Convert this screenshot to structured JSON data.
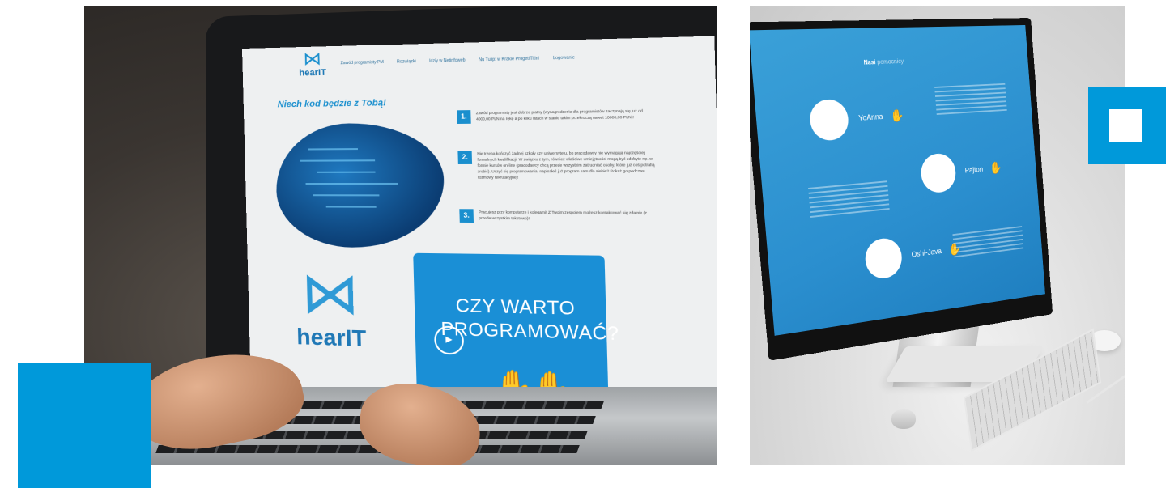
{
  "colors": {
    "accent": "#0099da",
    "screen_blue": "#1a8fd6"
  },
  "laptop_photo": {
    "site": {
      "logo_text": "hearIT",
      "nav": [
        "Zawód programisty PM",
        "Rozwiązki",
        "Idziy w Netinfoweb",
        "Nu Tulip: w Krakie ProgetITitini",
        "Logowanie"
      ],
      "headline": "Niech kod będzie z Tobą!",
      "points": [
        {
          "num": "1.",
          "text": "Zawód programisty jest dobrze płatny (wynagrodzenia dla programistów zaczynają się już od 4000,00 PLN na rękę a po kilku latach w stanie takim przekroczą nawet 10000,00 PLN)!"
        },
        {
          "num": "2.",
          "text": "Nie trzeba kończyć żadnej szkoły czy uniwersytetu, bo pracodawcy nie wymagają najczęściej formalnych kwalifikacji. W związku z tym, również właściwe umiejętności mogą być zdobyte np. w formie kursów on-line (pracodawcy chcą przede wszystkim zatrudniać osoby, które już coś potrafią zrobić). Uczyć się programowania, napisałeś już program sam dla siebie? Pokaż go podczas rozmowy rekrutacyjnej!"
        },
        {
          "num": "3.",
          "text": "Pracujesz przy komputerze i kolegami! Z Twoim zespołem możesz kontaktować się zdalnie (z przede wszystkim tekstowo)!"
        }
      ],
      "big_logo_text": "hearIT",
      "video_title": "CZY WARTO PROGRAMOWAĆ?"
    }
  },
  "desktop_photo": {
    "section_title": "Nasi",
    "section_title_rest": "pomocnicy",
    "items": [
      {
        "name": "YoAnna"
      },
      {
        "name": "Pajton"
      },
      {
        "name": "Oshi-Java"
      }
    ]
  }
}
